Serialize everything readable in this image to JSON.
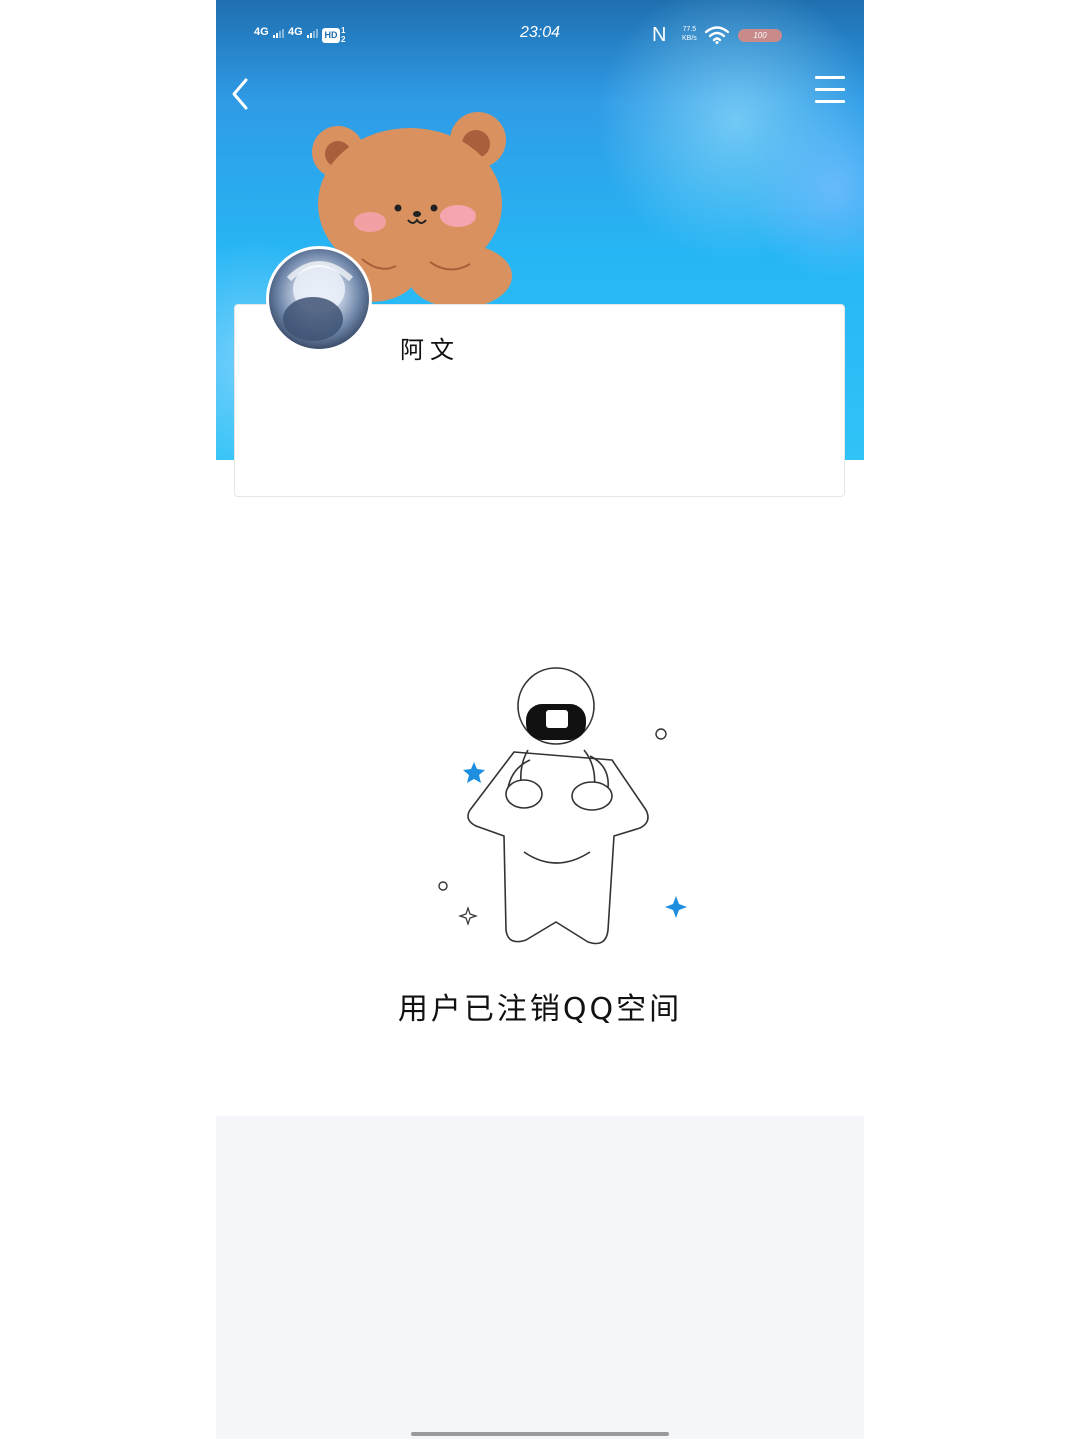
{
  "status_bar": {
    "signal_1": "4G",
    "signal_2": "4G",
    "hd": "HD",
    "hd_sub_1": "1",
    "hd_sub_2": "2",
    "time": "23:04",
    "nfc": "N",
    "net_speed_value": "77.5",
    "net_speed_unit": "KB/s",
    "battery": "100"
  },
  "nav": {
    "back_icon": "chevron-left-icon",
    "menu_icon": "hamburger-menu-icon"
  },
  "profile": {
    "username": "阿文"
  },
  "empty_state": {
    "message": "用户已注销QQ空间",
    "illustration": "astronaut-on-star-illustration"
  },
  "colors": {
    "cover_top": "#1f6fb0",
    "cover_bottom": "#30c3f7",
    "accent_star": "#1e8fe0",
    "bottom_bg": "#f5f6fa"
  }
}
